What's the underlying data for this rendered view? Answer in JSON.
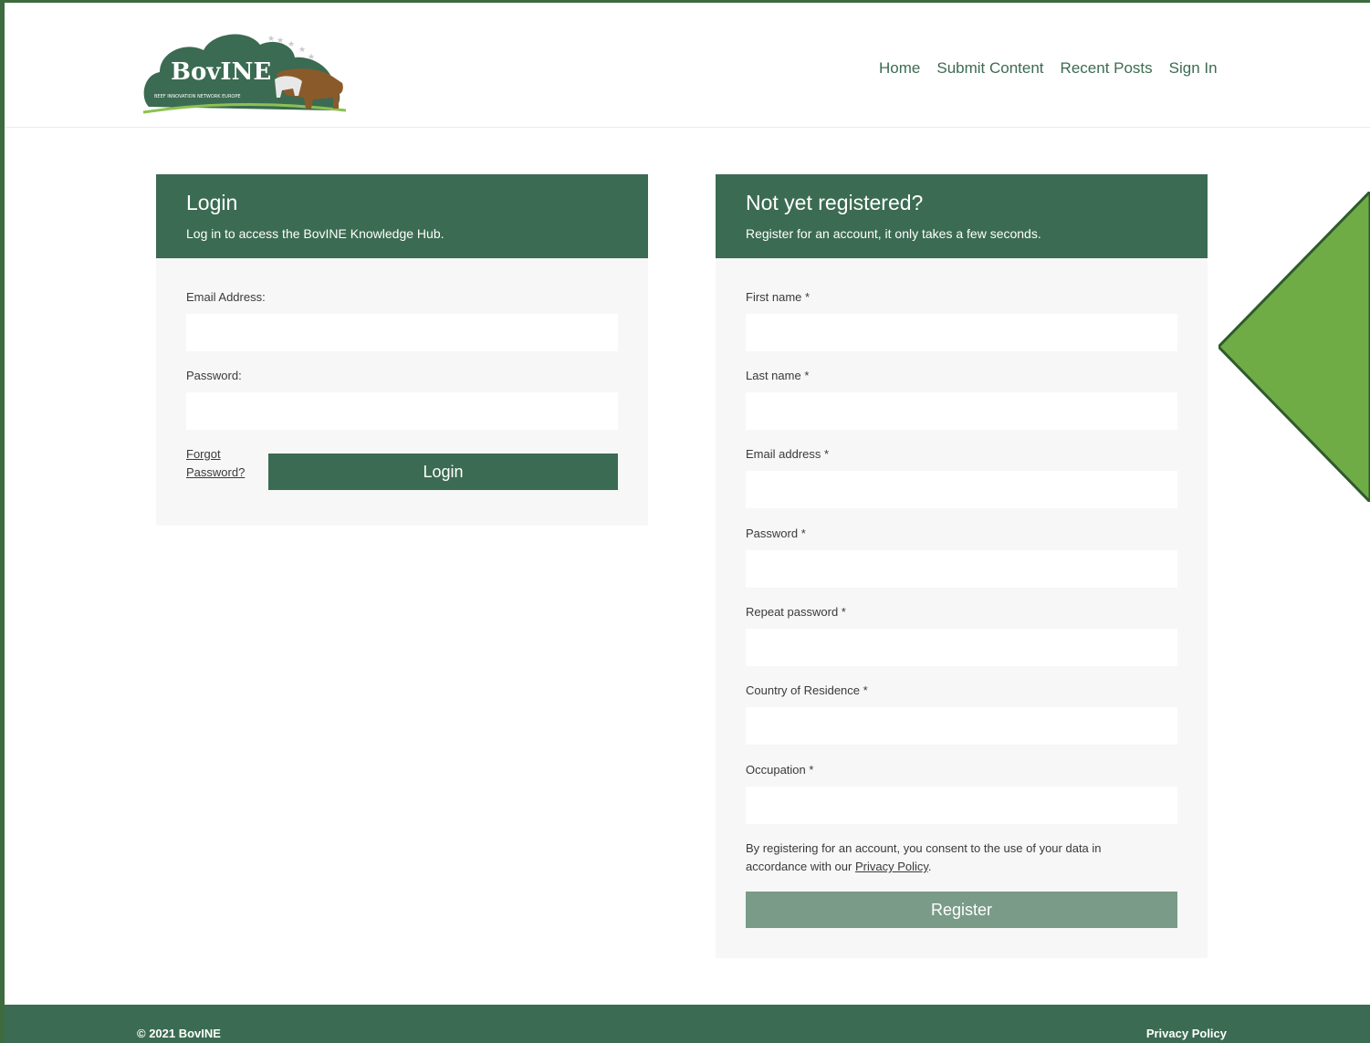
{
  "brand": {
    "name": "BovINE",
    "tagline": "BEEF INNOVATION NETWORK EUROPE",
    "colors": {
      "primary": "#3b6b52",
      "accent": "#6fac46",
      "frame": "#3d6b3f"
    }
  },
  "nav": {
    "items": [
      "Home",
      "Submit Content",
      "Recent Posts",
      "Sign In"
    ]
  },
  "login": {
    "title": "Login",
    "subtitle": "Log in to access the BovINE Knowledge Hub.",
    "email_label": "Email Address:",
    "password_label": "Password:",
    "forgot_line1": "Forgot",
    "forgot_line2": "Password?",
    "button": "Login"
  },
  "register": {
    "title": "Not yet registered?",
    "subtitle": "Register for an account, it only takes a few seconds.",
    "fields": [
      "First name *",
      "Last name *",
      "Email address *",
      "Password *",
      "Repeat password *",
      "Country of Residence *",
      "Occupation *"
    ],
    "consent_text": "By registering for an account, you consent to the use of your data in accordance with our",
    "consent_link": "Privacy Policy",
    "consent_end": ".",
    "button": "Register"
  },
  "footer": {
    "copyright": "© 2021 BovINE",
    "privacy": "Privacy Policy"
  }
}
